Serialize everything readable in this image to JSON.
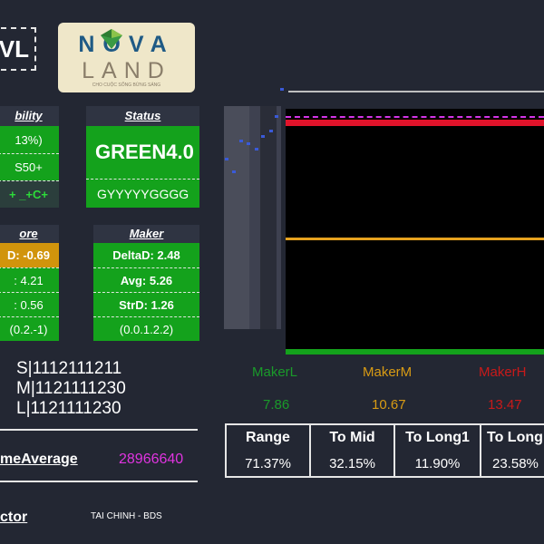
{
  "ticker": "VL",
  "logo": {
    "brand_top": "NOVA",
    "brand_bottom": "LAND",
    "tagline": "CHO CUỘC SỐNG BỪNG SÁNG"
  },
  "cards": {
    "stability": {
      "title": "bility",
      "row1": "13%)",
      "row2": "S50+",
      "row3": "+ _+C+"
    },
    "status": {
      "title": "Status",
      "value": "GREEN4.0",
      "code": "GYYYYYGGGG"
    },
    "score": {
      "title": "ore",
      "row1": "D: -0.69",
      "row2": ": 4.21",
      "row3": ": 0.56",
      "row4": "(0.2.-1)"
    },
    "maker": {
      "title": "Maker",
      "delta": "DeltaD: 2.48",
      "avg": "Avg: 5.26",
      "strd": "StrD: 1.26",
      "params": "(0.0.1.2.2)"
    }
  },
  "slr": {
    "s": "S|1112111211",
    "m": "M|1121111230",
    "l": "L|1121111230"
  },
  "volume": {
    "label": "meAverage",
    "value": "28966640"
  },
  "sector": {
    "label": "ctor",
    "value": "TAI CHINH - BDS"
  },
  "makers": [
    {
      "label": "MakerL",
      "value": "7.86",
      "color": "#1a9a2a"
    },
    {
      "label": "MakerM",
      "value": "10.67",
      "color": "#d89b14"
    },
    {
      "label": "MakerH",
      "value": "13.47",
      "color": "#c81a1a"
    }
  ],
  "metrics": [
    {
      "label": "Range",
      "value": "71.37%"
    },
    {
      "label": "To Mid",
      "value": "32.15%"
    },
    {
      "label": "To Long1",
      "value": "11.90%"
    },
    {
      "label": "To Long",
      "value": "23.58%"
    }
  ],
  "colors": {
    "background": "#232733",
    "green": "#14a21c",
    "orange": "#d1940c",
    "red": "#e0132a",
    "magenta": "#e034e0"
  },
  "icons": {
    "logo_mark": "nova-diamond-icon"
  }
}
